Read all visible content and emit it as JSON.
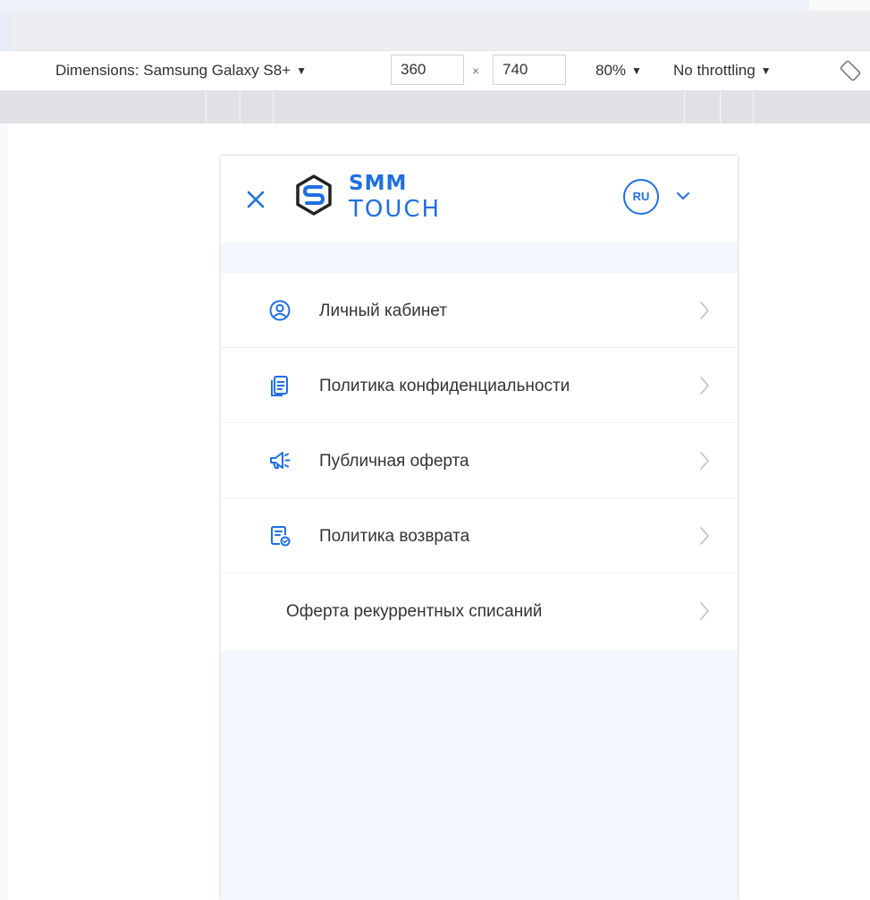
{
  "devtools": {
    "dimensions_label": "Dimensions: Samsung Galaxy S8+",
    "width_value": "360",
    "height_value": "740",
    "times_sign": "×",
    "zoom": "80%",
    "throttling": "No throttling",
    "dropdown_arrow": "▼"
  },
  "header": {
    "logo_top": "SMM",
    "logo_bottom": "TOUCH",
    "language": "RU"
  },
  "menu": {
    "items": [
      {
        "label": "Личный кабинет",
        "icon": "user-circle-icon"
      },
      {
        "label": "Политика конфиденциальности",
        "icon": "document-icon"
      },
      {
        "label": "Публичная оферта",
        "icon": "megaphone-icon"
      },
      {
        "label": "Политика возврата",
        "icon": "refund-document-icon"
      },
      {
        "label": "Оферта рекуррентных списаний",
        "icon": ""
      }
    ]
  },
  "colors": {
    "accent": "#1f6fe0",
    "page_bg": "#f2f6fd"
  }
}
